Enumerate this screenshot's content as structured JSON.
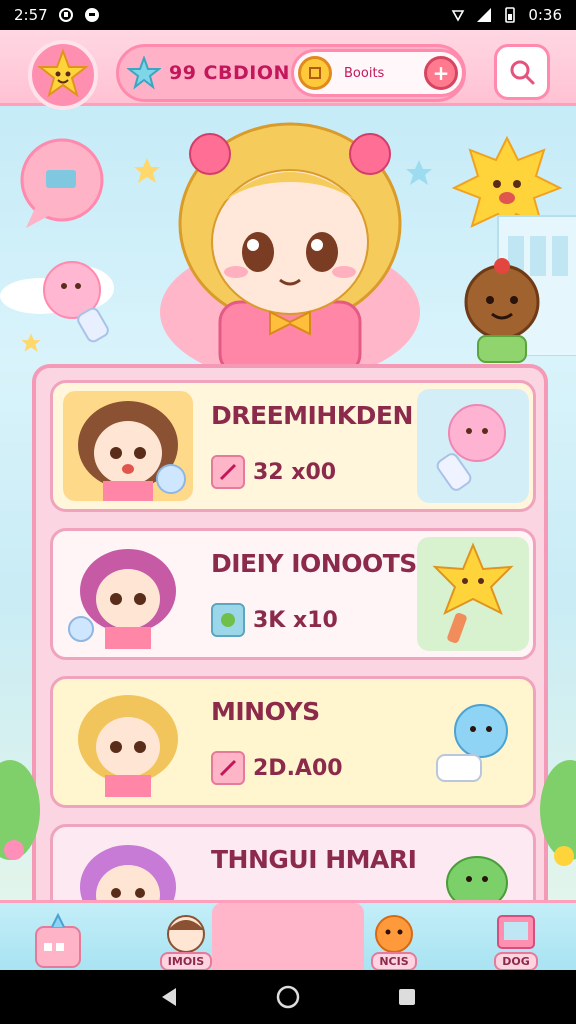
{
  "status_bar": {
    "time": "2:57",
    "clock_right": "0:36"
  },
  "header": {
    "currency_label": "99 CBDION",
    "score_label": "Booits",
    "plus_symbol": "+"
  },
  "cards": [
    {
      "title": "DREEMIHKDEN",
      "score": "32 x00"
    },
    {
      "title": "DIEIY IONOOTS",
      "score": "3K x10"
    },
    {
      "title": "MINOYS",
      "score": "2D.A00"
    },
    {
      "title": "THNGUI HMARIN",
      "score": ""
    }
  ],
  "bottom_nav": {
    "items": [
      {
        "label": ""
      },
      {
        "label": "IMOIS"
      },
      {
        "label": ""
      },
      {
        "label": "NCIS"
      },
      {
        "label": "DOG"
      }
    ]
  },
  "colors": {
    "accent": "#ff8aad",
    "panel": "#fbd6e2",
    "text": "#8b2a4a"
  }
}
